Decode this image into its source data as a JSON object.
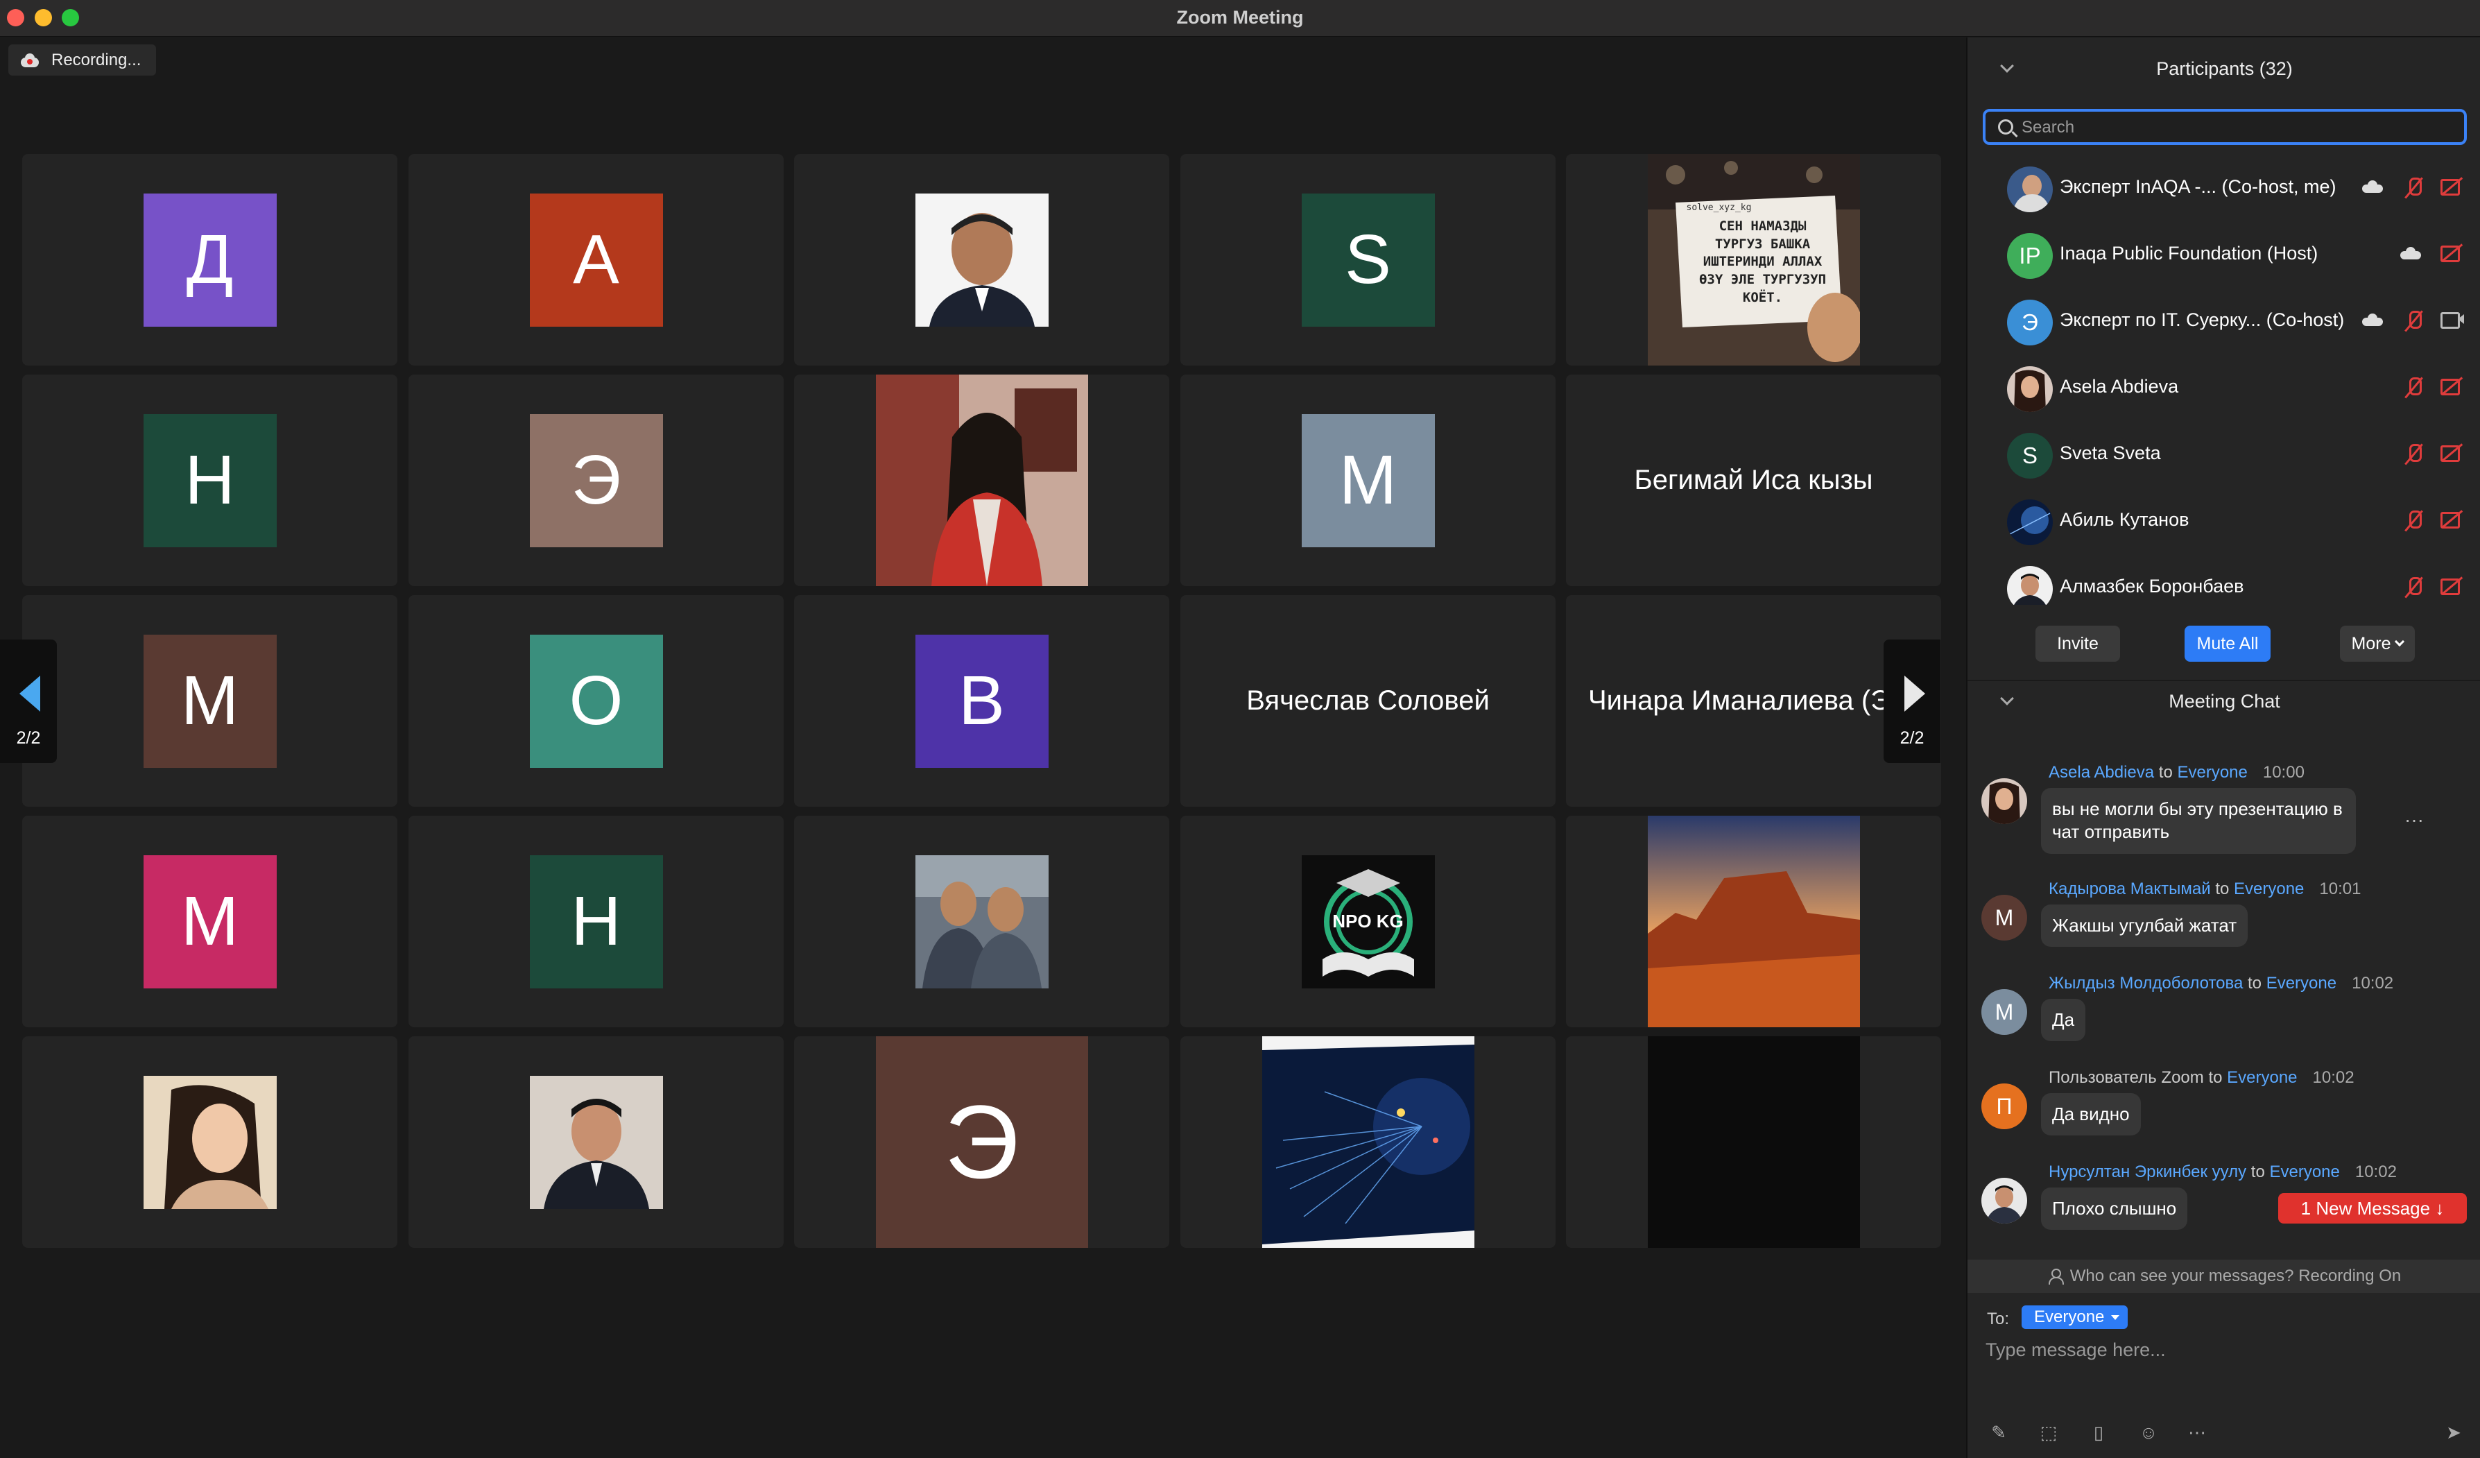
{
  "window": {
    "title": "Zoom Meeting"
  },
  "recording": {
    "label": "Recording..."
  },
  "gallery": {
    "page": "2/2",
    "tiles": [
      {
        "kind": "avatar",
        "letter": "Д",
        "color": "#7752c8"
      },
      {
        "kind": "avatar",
        "letter": "A",
        "color": "#b4391c"
      },
      {
        "kind": "photo",
        "desc": "portrait-man"
      },
      {
        "kind": "avatar",
        "letter": "S",
        "color": "#1c4a3a"
      },
      {
        "kind": "photo",
        "desc": "quote-card"
      },
      {
        "kind": "avatar",
        "letter": "H",
        "color": "#1c4a3a"
      },
      {
        "kind": "avatar",
        "letter": "Э",
        "color": "#8e7166"
      },
      {
        "kind": "photo",
        "desc": "woman-red-jacket"
      },
      {
        "kind": "avatar",
        "letter": "M",
        "color": "#7b8d9e"
      },
      {
        "kind": "name",
        "text": "Бегимай Иса кызы"
      },
      {
        "kind": "avatar",
        "letter": "M",
        "color": "#5a3a32"
      },
      {
        "kind": "avatar",
        "letter": "O",
        "color": "#3a8f7d"
      },
      {
        "kind": "avatar",
        "letter": "B",
        "color": "#4e33a8"
      },
      {
        "kind": "name",
        "text": "Вячеслав Соловей"
      },
      {
        "kind": "name",
        "text": "Чинара Иманалиева (Экс"
      },
      {
        "kind": "avatar",
        "letter": "M",
        "color": "#c72a64"
      },
      {
        "kind": "avatar",
        "letter": "H",
        "color": "#1c4a3a"
      },
      {
        "kind": "photo",
        "desc": "two-men"
      },
      {
        "kind": "photo",
        "desc": "npo-kg-logo"
      },
      {
        "kind": "photo",
        "desc": "desert-canyon"
      },
      {
        "kind": "photo",
        "desc": "woman-selfie"
      },
      {
        "kind": "photo",
        "desc": "man-suit"
      },
      {
        "kind": "avatar-big",
        "letter": "Э",
        "color": "#5a3a32"
      },
      {
        "kind": "photo",
        "desc": "network-brain"
      },
      {
        "kind": "photo",
        "desc": "dark"
      }
    ],
    "quote_text": "СЕН НАМАЗДЫ ТУРГУЗ БАШКА ИШТЕРИНДИ АЛЛАХ ӨЗҮ ЭЛЕ ТУРГУЗУП КОЁТ.",
    "quote_handle": "solve_xyz_kg",
    "npo_text": "NPO KG"
  },
  "participants": {
    "header": "Participants (32)",
    "search_placeholder": "Search",
    "list": [
      {
        "name": "Эксперт InAQA -...    (Co-host, me)",
        "avatar": "photo",
        "cloud": true,
        "mic": "off",
        "cam": "off"
      },
      {
        "name": "Inaqa Public Foundation (Host)",
        "avatar": "IP",
        "color": "#3fae5a",
        "cloud": true,
        "mic": "none",
        "cam": "off"
      },
      {
        "name": "Эксперт по IT. Суерку...  (Co-host)",
        "avatar": "Э",
        "color": "#3a8fd6",
        "cloud": true,
        "mic": "off",
        "cam": "on"
      },
      {
        "name": "Asela Abdieva",
        "avatar": "photo",
        "mic": "off",
        "cam": "off"
      },
      {
        "name": "Sveta Sveta",
        "avatar": "S",
        "color": "#1c4a3a",
        "mic": "off",
        "cam": "off"
      },
      {
        "name": "Абиль Кутанов",
        "avatar": "photo",
        "mic": "off",
        "cam": "off"
      },
      {
        "name": "Алмазбек Боронбаев",
        "avatar": "photo",
        "mic": "off",
        "cam": "off"
      }
    ],
    "buttons": {
      "invite": "Invite",
      "mute_all": "Mute All",
      "more": "More"
    }
  },
  "chat": {
    "header": "Meeting Chat",
    "to_word": "to",
    "messages": [
      {
        "sender": "Asela Abdieva",
        "recipient": "Everyone",
        "time": "10:00",
        "text": "вы не могли бы эту презентацию в чат отправить",
        "avatar": "photo"
      },
      {
        "sender": "Кадырова Мактымай",
        "recipient": "Everyone",
        "time": "10:01",
        "text": "Жакшы угулбай жатат",
        "avatar": "M",
        "color": "#5a3a32"
      },
      {
        "sender": "Жылдыз Молдоболотова",
        "recipient": "Everyone",
        "time": "10:02",
        "text": "Да",
        "avatar": "M",
        "color": "#7b8d9e"
      },
      {
        "sender": "Пользователь Zoom",
        "recipient": "Everyone",
        "time": "10:02",
        "text": "Да видно",
        "avatar": "П",
        "color": "#e5711f"
      },
      {
        "sender": "Нурсултан Эркинбек уулу",
        "recipient": "Everyone",
        "time": "10:02",
        "text": "Плохо слышно",
        "avatar": "photo"
      }
    ],
    "more_dots": "···",
    "new_message_button": "1 New Message ↓",
    "privacy_note": "Who can see your messages? Recording On",
    "to_label": "To:",
    "to_value": "Everyone",
    "input_placeholder": "Type message here..."
  }
}
